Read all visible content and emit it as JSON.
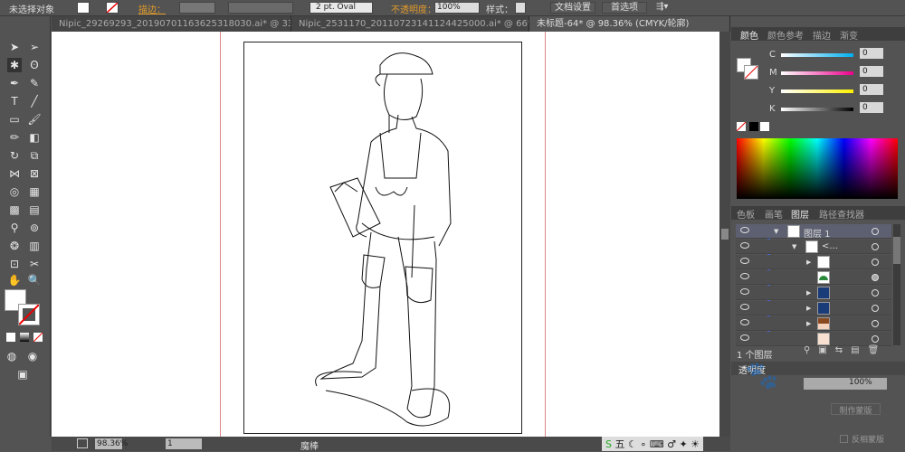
{
  "control_bar": {
    "selection": "未选择对象",
    "stroke_label": "描边：",
    "brush": "2 pt. Oval",
    "opacity_label": "不透明度：",
    "opacity": "100%",
    "style_label": "样式：",
    "doc_setup": "文档设置",
    "preferences": "首选项"
  },
  "tabs": [
    {
      "label": "Nipic_29269293_20190701163625318030.ai* @ 33...",
      "active": false
    },
    {
      "label": "Nipic_2531170_20110723141124425000.ai* @ 66%...",
      "active": false
    },
    {
      "label": "未标题-64* @ 98.36% (CMYK/轮廓)",
      "active": true
    }
  ],
  "color_panel": {
    "tabs": [
      "颜色",
      "颜色参考",
      "描边",
      "渐变"
    ],
    "channels": [
      {
        "name": "C",
        "value": "0",
        "color": "#00aeef"
      },
      {
        "name": "M",
        "value": "0",
        "color": "#ec008c"
      },
      {
        "name": "Y",
        "value": "0",
        "color": "#fff200"
      },
      {
        "name": "K",
        "value": "0",
        "color": "#000000"
      }
    ]
  },
  "layers_panel": {
    "tabs": [
      "色板",
      "画笔",
      "图层",
      "路径查找器"
    ],
    "layer_name": "图层 1",
    "group_name": "<...",
    "footer": "1 个图层",
    "rows": [
      {
        "thumb": "#fff"
      },
      {
        "thumb": "#2a8a3a"
      },
      {
        "thumb": "#1a3c78"
      },
      {
        "thumb": "#1a3c78"
      },
      {
        "thumb": "#8a4a20"
      },
      {
        "thumb": "#f8e0d0"
      }
    ]
  },
  "transparency_panel": {
    "title": "透明度",
    "opacity": "100%",
    "make_mask": "制作蒙版",
    "invert_mask": "反相蒙版"
  },
  "status_bar": {
    "zoom": "98.36%",
    "page": "1",
    "tool": "魔棒"
  },
  "ime": {
    "label": "五"
  }
}
